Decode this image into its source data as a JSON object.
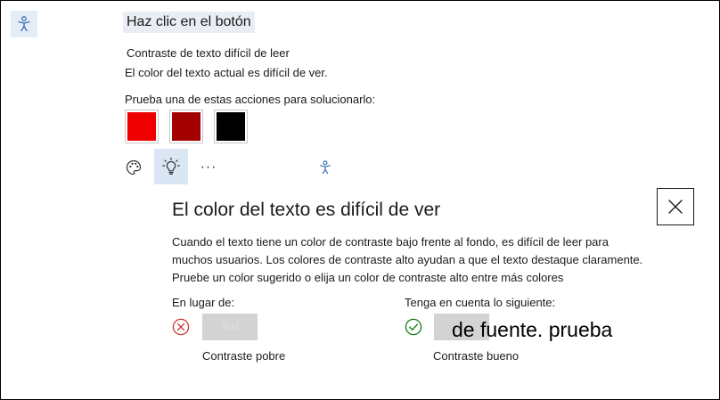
{
  "heading": "Haz clic en el botón",
  "issue": {
    "title": "Contraste de texto difícil de leer",
    "detail": "El color del texto actual es difícil de ver.",
    "prompt": "Prueba una de estas acciones para solucionarlo:"
  },
  "swatches": [
    {
      "name": "red",
      "color": "#ee0000"
    },
    {
      "name": "dark-red",
      "color": "#a30000"
    },
    {
      "name": "black",
      "color": "#000000"
    }
  ],
  "toolbar": {
    "more_label": "···"
  },
  "panel": {
    "title": "El color del texto es difícil de ver",
    "description": "Cuando el texto tiene un color de contraste bajo frente al fondo, es difícil de leer para muchos usuarios. Los colores de contraste alto ayudan a que el texto destaque claramente. Pruebe un color sugerido o elija un color de contraste alto entre más colores",
    "bad": {
      "heading": "En lugar de:",
      "sample": "Text",
      "caption": "Contraste pobre"
    },
    "good": {
      "heading": "Tenga en cuenta lo siguiente:",
      "caption": "Contraste bueno"
    },
    "overlay_text": "de fuente. prueba"
  },
  "colors": {
    "accent": "#3b6fb0",
    "error": "#d13438",
    "success": "#107c10"
  }
}
